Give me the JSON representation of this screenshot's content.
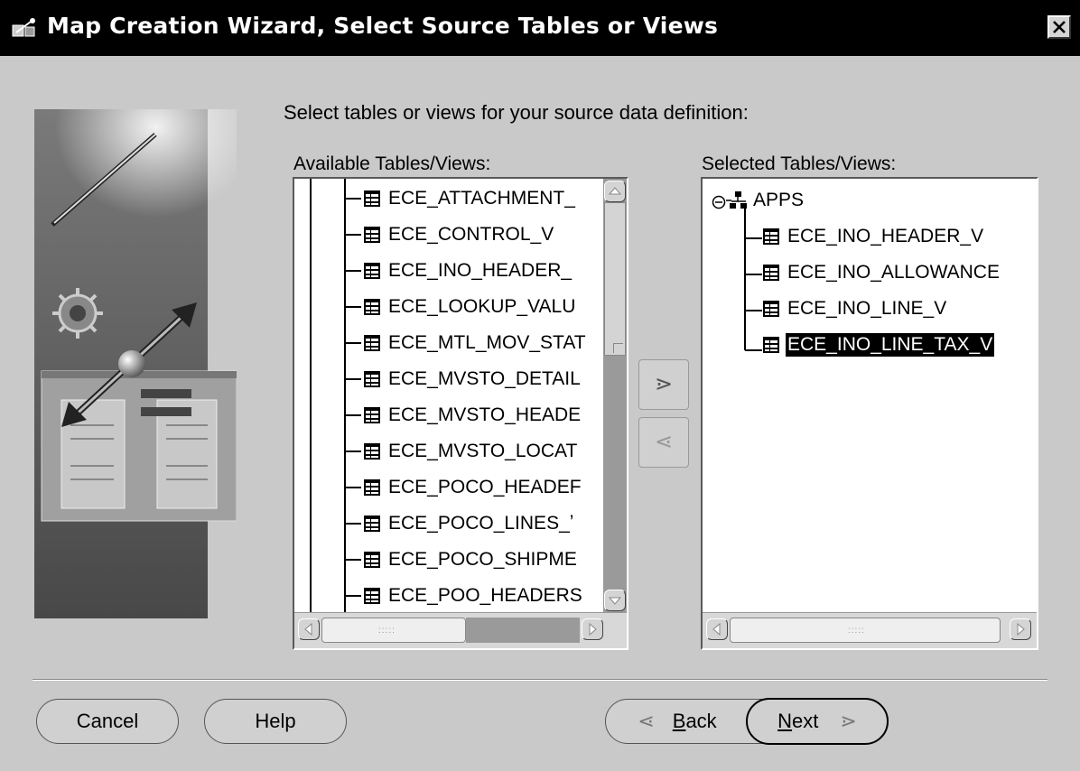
{
  "window": {
    "title": "Map Creation Wizard, Select Source Tables or Views",
    "title_icon": "wizard-app-icon",
    "close_icon": "close-icon"
  },
  "instruction": "Select tables or views for your source data definition:",
  "available": {
    "label": "Available Tables/Views:",
    "items": [
      "ECE_ATTACHMENT_",
      "ECE_CONTROL_V",
      "ECE_INO_HEADER_",
      "ECE_LOOKUP_VALU",
      "ECE_MTL_MOV_STAT",
      "ECE_MVSTO_DETAIL",
      "ECE_MVSTO_HEADE",
      "ECE_MVSTO_LOCAT",
      "ECE_POCO_HEADEF",
      "ECE_POCO_LINES_ʼ",
      "ECE_POCO_SHIPME",
      "ECE_POO_HEADERS"
    ]
  },
  "selected": {
    "label": "Selected Tables/Views:",
    "root": "APPS",
    "items": [
      "ECE_INO_HEADER_V",
      "ECE_INO_ALLOWANCE",
      "ECE_INO_LINE_V",
      "ECE_INO_LINE_TAX_V"
    ],
    "selected_index": 3
  },
  "move_buttons": {
    "add_glyph": "⋗",
    "remove_glyph": "⋖"
  },
  "buttons": {
    "cancel": "Cancel",
    "help": "Help",
    "back": "Back",
    "back_mnemonic": "B",
    "back_rest": "ack",
    "next": "Next",
    "next_mnemonic": "N",
    "next_rest": "ext",
    "back_glyph": "⋖",
    "next_glyph": "⋗"
  },
  "colors": {
    "background": "#c9c9c9",
    "titlebar": "#000000",
    "selection": "#000000",
    "list_background": "#ffffff"
  }
}
